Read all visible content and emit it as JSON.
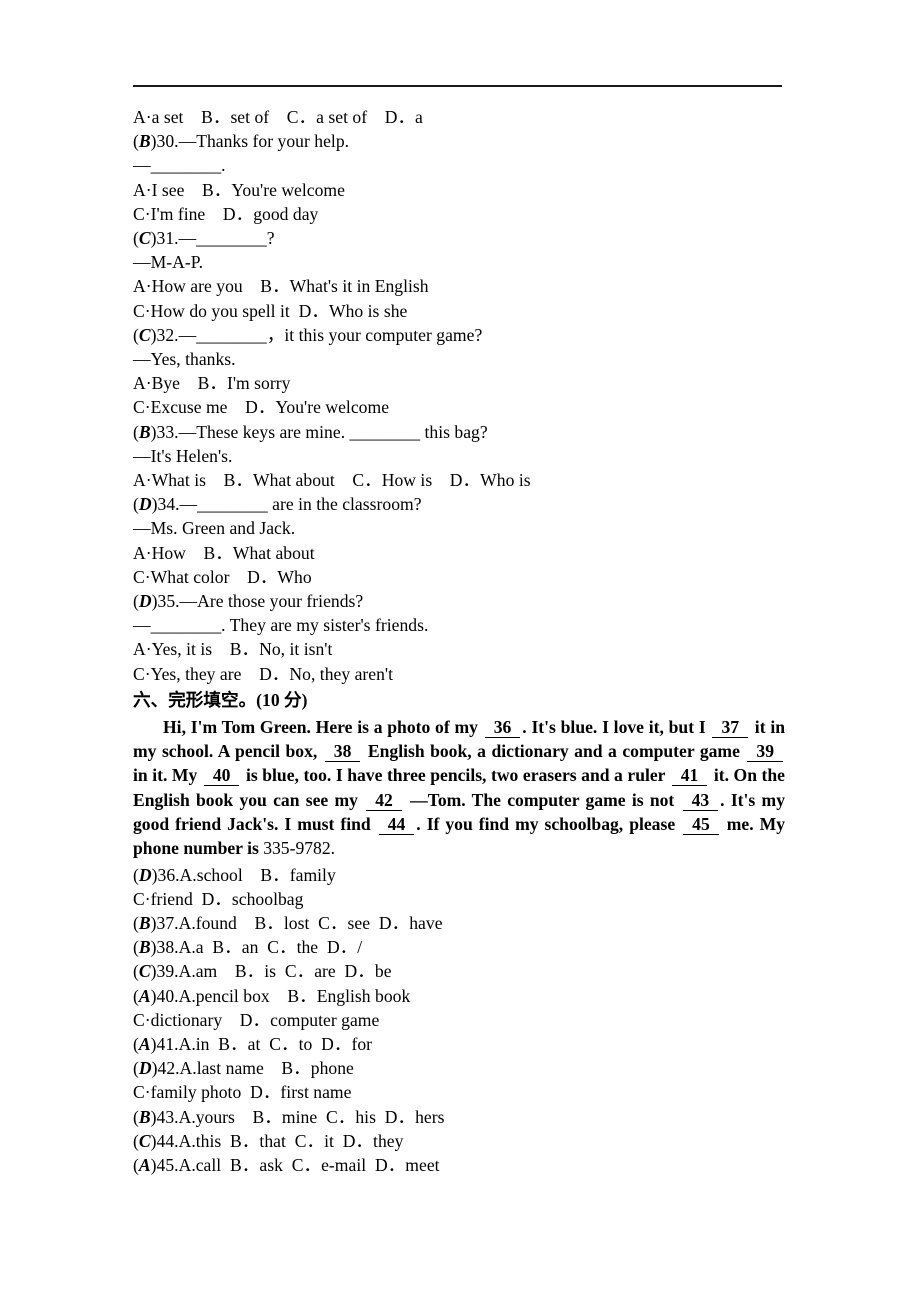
{
  "document": {
    "type": "english-exam-worksheet",
    "divider": "horizontal-rule"
  },
  "top_options": {
    "line": "A·a set B．set of C．a set of D．a"
  },
  "questions": [
    {
      "answer": "B",
      "number": "30",
      "stem": ")30.—Thanks for your help.",
      "reply": "—________.",
      "options_line1": "A·I see B．You're welcome",
      "options_line2": "C·I'm fine D．good day"
    },
    {
      "answer": "C",
      "number": "31",
      "stem": ")31.—________?",
      "reply": "—M-A-P.",
      "options_line1": "A·How are you B．What's it in English",
      "options_line2": "C·How do you spell it D．Who is she"
    },
    {
      "answer": "C",
      "number": "32",
      "stem": ")32.—________，it this your computer game?",
      "reply": "—Yes, thanks.",
      "options_line1": "A·Bye B．I'm sorry",
      "options_line2": "C·Excuse me D．You're welcome"
    },
    {
      "answer": "B",
      "number": "33",
      "stem": ")33.—These keys are mine. ________ this bag?",
      "reply": "—It's Helen's.",
      "options_line1": "A·What is B．What about C．How is D．Who is",
      "options_line2": ""
    },
    {
      "answer": "D",
      "number": "34",
      "stem": ")34.—________ are in the classroom?",
      "reply": "—Ms. Green and Jack.",
      "options_line1": "A·How B．What about",
      "options_line2": "C·What color D．Who"
    },
    {
      "answer": "D",
      "number": "35",
      "stem": ")35.—Are those your friends?",
      "reply": "—________. They are my sister's friends.",
      "options_line1": "A·Yes, it is B．No, it isn't",
      "options_line2": "C·Yes, they are D．No, they aren't"
    }
  ],
  "cloze_section": {
    "heading_cn": "六、完形填空。",
    "heading_score": "(10 分)",
    "passage_parts": [
      {
        "text": "Hi, I'm Tom Green. Here is a photo of my ",
        "type": "text"
      },
      {
        "text": "36",
        "type": "blank"
      },
      {
        "text": ". It's blue. I love it, but I ",
        "type": "text"
      },
      {
        "text": "37",
        "type": "blank"
      },
      {
        "text": " it in my school. A pencil box, ",
        "type": "text"
      },
      {
        "text": "38",
        "type": "blank"
      },
      {
        "text": " English book, a dictionary and a computer game ",
        "type": "text"
      },
      {
        "text": "39",
        "type": "blank"
      },
      {
        "text": " in it. My ",
        "type": "text"
      },
      {
        "text": "40",
        "type": "blank"
      },
      {
        "text": " is blue, too. I have three pencils, two erasers and a ruler ",
        "type": "text"
      },
      {
        "text": "41",
        "type": "blank"
      },
      {
        "text": " it. On the English book you can see my ",
        "type": "text"
      },
      {
        "text": "42",
        "type": "blank"
      },
      {
        "text": " —Tom. The computer game is not ",
        "type": "text"
      },
      {
        "text": "43",
        "type": "blank"
      },
      {
        "text": ". It's my good friend Jack's. I must find ",
        "type": "text"
      },
      {
        "text": "44",
        "type": "blank"
      },
      {
        "text": ". If you find my schoolbag, please ",
        "type": "text"
      },
      {
        "text": "45",
        "type": "blank"
      },
      {
        "text": " me. My phone number is ",
        "type": "text"
      },
      {
        "text": "335-9782.",
        "type": "nonbold"
      }
    ]
  },
  "cloze_questions": [
    {
      "answer": "D",
      "line1": ")36.A.school B．family",
      "line2": "C·friend D．schoolbag"
    },
    {
      "answer": "B",
      "line1": ")37.A.found B．lost C．see D．have",
      "line2": ""
    },
    {
      "answer": "B",
      "line1": ")38.A.a B．an C．the D．/",
      "line2": ""
    },
    {
      "answer": "C",
      "line1": ")39.A.am B．is C．are D．be",
      "line2": ""
    },
    {
      "answer": "A",
      "line1": ")40.A.pencil box B．English book",
      "line2": "C·dictionary D．computer game"
    },
    {
      "answer": "A",
      "line1": ")41.A.in B．at C．to D．for",
      "line2": ""
    },
    {
      "answer": "D",
      "line1": ")42.A.last name B．phone",
      "line2": "C·family photo D．first name"
    },
    {
      "answer": "B",
      "line1": ")43.A.yours B．mine C．his D．hers",
      "line2": ""
    },
    {
      "answer": "C",
      "line1": ")44.A.this B．that C．it D．they",
      "line2": ""
    },
    {
      "answer": "A",
      "line1": ")45.A.call B．ask C．e-mail D．meet",
      "line2": ""
    }
  ]
}
